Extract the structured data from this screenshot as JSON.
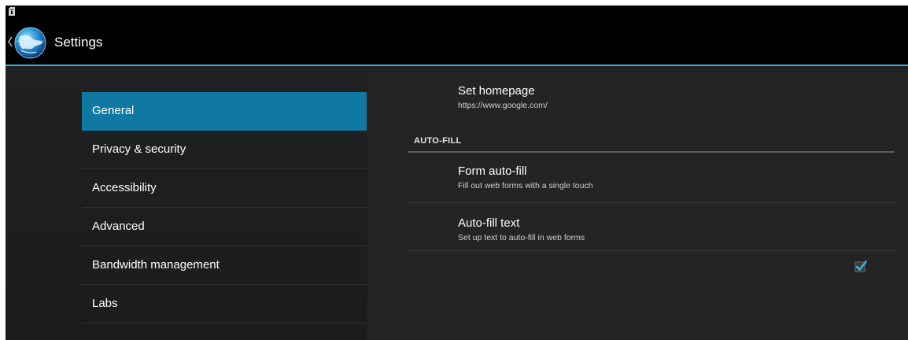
{
  "action_bar": {
    "title": "Settings",
    "icon": "browser-globe-icon"
  },
  "status_bar": {
    "icon": "sd-card-icon"
  },
  "headers": [
    {
      "label": "General",
      "active": true
    },
    {
      "label": "Privacy & security",
      "active": false
    },
    {
      "label": "Accessibility",
      "active": false
    },
    {
      "label": "Advanced",
      "active": false
    },
    {
      "label": "Bandwidth management",
      "active": false
    },
    {
      "label": "Labs",
      "active": false
    }
  ],
  "general": {
    "set_homepage": {
      "title": "Set homepage",
      "summary": "https://www.google.com/"
    },
    "autofill_category": "AUTO-FILL",
    "form_autofill": {
      "title": "Form auto-fill",
      "summary": "Fill out web forms with a single touch",
      "checked": true
    },
    "autofill_text": {
      "title": "Auto-fill text",
      "summary": "Set up text to auto-fill in web forms"
    }
  },
  "colors": {
    "accent": "#33b5e5",
    "selected": "#0f79a3",
    "checkbox_check": "#33b5e5"
  }
}
